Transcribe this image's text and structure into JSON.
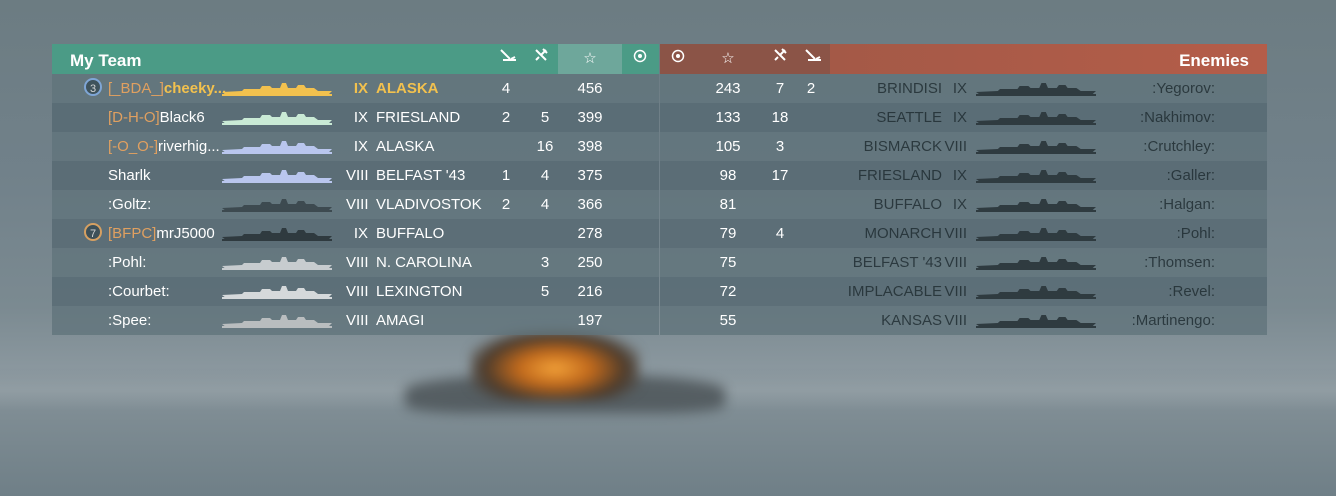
{
  "colors": {
    "team_header": "#4b9b86",
    "enemy_header": "#b45d49",
    "clan_tag": "#e0a060",
    "highlight": "#f2c14e"
  },
  "icons": {
    "kills": "ship-sunk-icon",
    "planes": "planes-destroyed-icon",
    "xp": "star-icon",
    "rank": "laurel-emblem-icon"
  },
  "left_team": {
    "title": "My Team",
    "rows": [
      {
        "division": "3",
        "clan": "[_BDA_]",
        "player": "cheeky...",
        "tier": "IX",
        "ship": "ALASKA",
        "kills": "4",
        "planes": "",
        "xp": "456",
        "highlight": true,
        "sil_color": "#f2c14e"
      },
      {
        "division": "",
        "clan": "[D-H-O]",
        "player": "Black6",
        "tier": "IX",
        "ship": "FRIESLAND",
        "kills": "2",
        "planes": "5",
        "xp": "399",
        "highlight": false,
        "sil_color": "#c9ead5"
      },
      {
        "division": "",
        "clan": "[-O_O-]",
        "player": "riverhig...",
        "tier": "IX",
        "ship": "ALASKA",
        "kills": "",
        "planes": "16",
        "xp": "398",
        "highlight": false,
        "sil_color": "#b9c6ee"
      },
      {
        "division": "",
        "clan": "",
        "player": "Sharlk",
        "tier": "VIII",
        "ship": "BELFAST '43",
        "kills": "1",
        "planes": "4",
        "xp": "375",
        "highlight": false,
        "sil_color": "#b9c6ee"
      },
      {
        "division": "",
        "clan": "",
        "player": ":Goltz:",
        "tier": "VIII",
        "ship": "VLADIVOSTOK",
        "kills": "2",
        "planes": "4",
        "xp": "366",
        "highlight": false,
        "sil_color": "#3d4a50"
      },
      {
        "division": "7",
        "clan": "[BFPC]",
        "player": "mrJ5000",
        "tier": "IX",
        "ship": "BUFFALO",
        "kills": "",
        "planes": "",
        "xp": "278",
        "highlight": false,
        "sil_color": "#2f3a3f"
      },
      {
        "division": "",
        "clan": "",
        "player": ":Pohl:",
        "tier": "VIII",
        "ship": "N. CAROLINA",
        "kills": "",
        "planes": "3",
        "xp": "250",
        "highlight": false,
        "sil_color": "#c7cccf"
      },
      {
        "division": "",
        "clan": "",
        "player": ":Courbet:",
        "tier": "VIII",
        "ship": "LEXINGTON",
        "kills": "",
        "planes": "5",
        "xp": "216",
        "highlight": false,
        "sil_color": "#d5d9db"
      },
      {
        "division": "",
        "clan": "",
        "player": ":Spee:",
        "tier": "VIII",
        "ship": "AMAGI",
        "kills": "",
        "planes": "",
        "xp": "197",
        "highlight": false,
        "sil_color": "#b9bdbf"
      }
    ]
  },
  "right_team": {
    "title": "Enemies",
    "rows": [
      {
        "xp": "243",
        "planes": "7",
        "kills": "2",
        "ship": "BRINDISI",
        "tier": "IX",
        "player": ":Yegorov:"
      },
      {
        "xp": "133",
        "planes": "18",
        "kills": "",
        "ship": "SEATTLE",
        "tier": "IX",
        "player": ":Nakhimov:"
      },
      {
        "xp": "105",
        "planes": "3",
        "kills": "",
        "ship": "BISMARCK",
        "tier": "VIII",
        "player": ":Crutchley:"
      },
      {
        "xp": "98",
        "planes": "17",
        "kills": "",
        "ship": "FRIESLAND",
        "tier": "IX",
        "player": ":Galler:"
      },
      {
        "xp": "81",
        "planes": "",
        "kills": "",
        "ship": "BUFFALO",
        "tier": "IX",
        "player": ":Halgan:"
      },
      {
        "xp": "79",
        "planes": "4",
        "kills": "",
        "ship": "MONARCH",
        "tier": "VIII",
        "player": ":Pohl:"
      },
      {
        "xp": "75",
        "planes": "",
        "kills": "",
        "ship": "BELFAST '43",
        "tier": "VIII",
        "player": ":Thomsen:"
      },
      {
        "xp": "72",
        "planes": "",
        "kills": "",
        "ship": "IMPLACABLE",
        "tier": "VIII",
        "player": ":Revel:"
      },
      {
        "xp": "55",
        "planes": "",
        "kills": "",
        "ship": "KANSAS",
        "tier": "VIII",
        "player": ":Martinengo:"
      }
    ]
  }
}
